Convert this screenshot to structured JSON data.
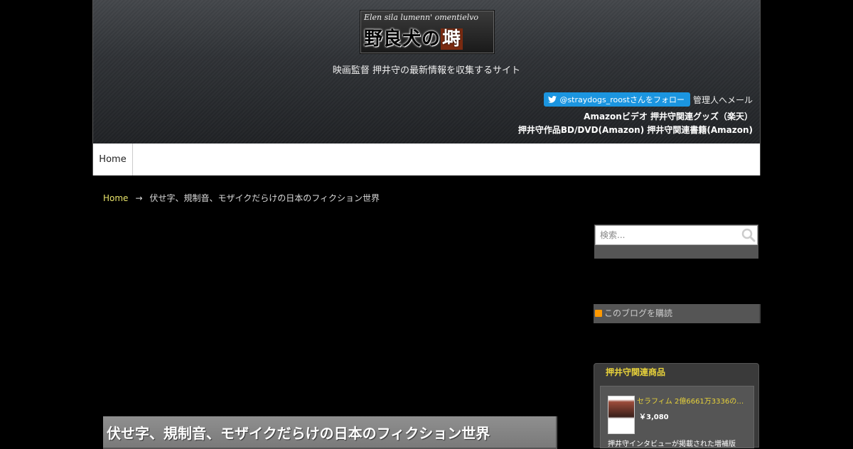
{
  "header": {
    "logo_script": "Elen sila lumenn' omentielvo",
    "logo_main": "野良犬の",
    "logo_accent": "塒",
    "tagline": "映画監督 押井守の最新情報を収集するサイト",
    "twitter_follow": "@straydogs_roostさんをフォロー",
    "admin_mail": "管理人へメール",
    "links_row2": "Amazonビデオ 押井守関連グッズ（楽天）",
    "links_row3": "押井守作品BD/DVD(Amazon) 押井守関連書籍(Amazon)"
  },
  "nav": {
    "home": "Home"
  },
  "breadcrumb": {
    "home": "Home",
    "arrow": "→",
    "current": "伏せ字、規制音、モザイクだらけの日本のフィクション世界"
  },
  "article": {
    "title": "伏せ字、規制音、モザイクだらけの日本のフィクション世界"
  },
  "sidebar": {
    "search_placeholder": "検索...",
    "rss_label": "このブログを購読",
    "products_title": "押井守関連商品",
    "product": {
      "name": "セラフィム 2億6661万3336の…",
      "price": "￥3,080",
      "desc": "押井守インタビューが掲載された増補版"
    }
  },
  "colors": {
    "accent_yellow": "#e8d23a",
    "twitter_blue": "#1b95e0",
    "link_home": "#e8e46a"
  }
}
